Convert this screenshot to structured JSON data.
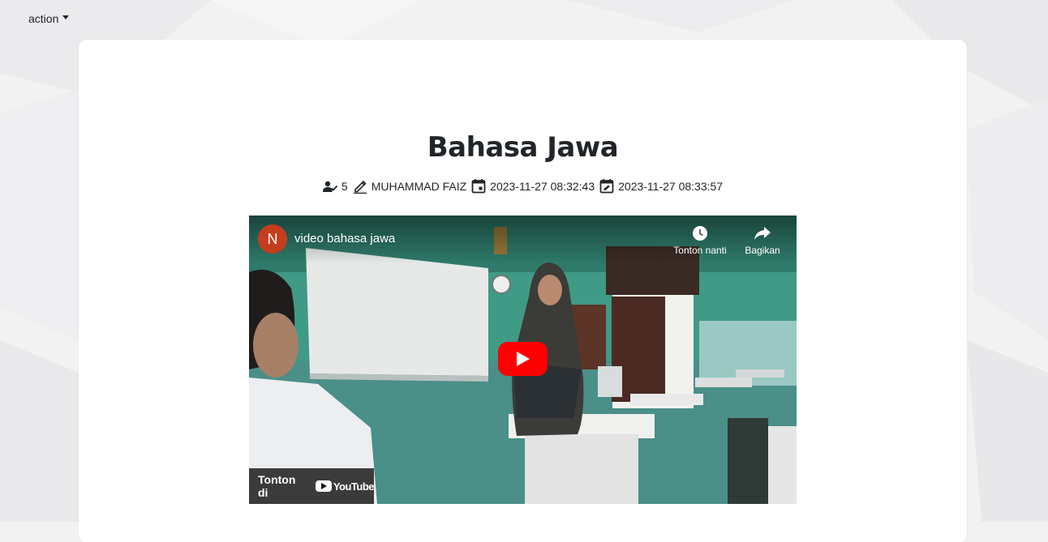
{
  "topbar": {
    "action_label": "action"
  },
  "article": {
    "title": "Bahasa Jawa",
    "meta": {
      "reader_count": "5",
      "author": "MUHAMMAD FAIZ",
      "created_at": "2023-11-27 08:32:43",
      "updated_at": "2023-11-27 08:33:57"
    }
  },
  "video": {
    "channel_initial": "N",
    "title": "video bahasa jawa",
    "watch_later_label": "Tonton nanti",
    "share_label": "Bagikan",
    "watch_on_label": "Tonton di",
    "youtube_label": "YouTube"
  },
  "colors": {
    "youtube_red": "#ff0000",
    "channel_avatar": "#c43d1e",
    "card_bg": "#ffffff",
    "page_bg": "#f2f2f3"
  }
}
